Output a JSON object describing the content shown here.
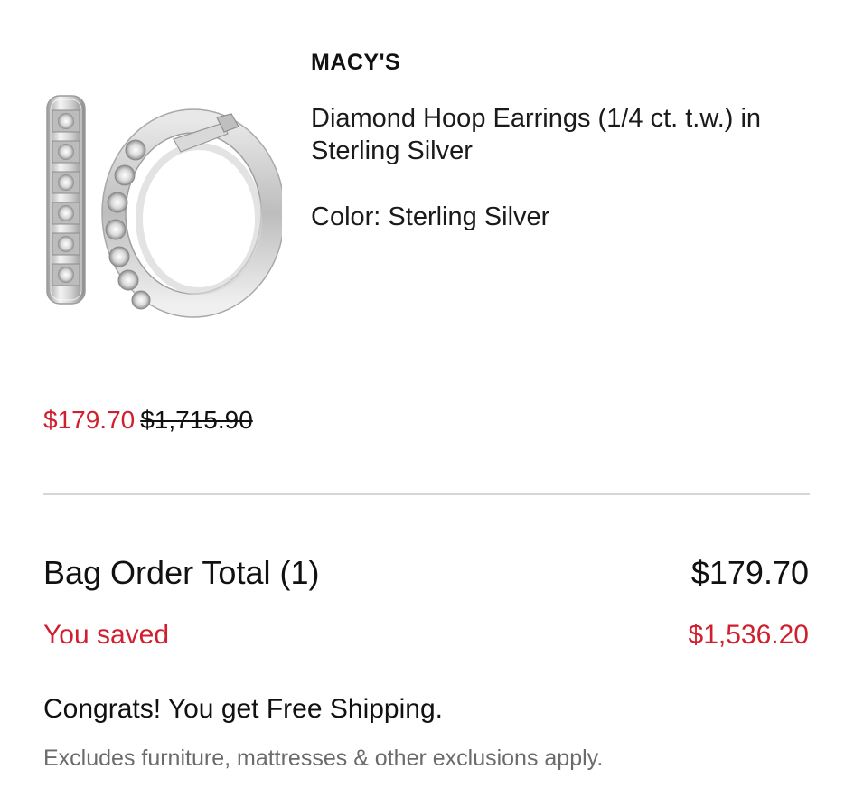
{
  "product": {
    "brand": "MACY'S",
    "name": "Diamond Hoop Earrings (1/4 ct. t.w.) in Sterling Silver",
    "color": "Color: Sterling Silver",
    "sale_price": "$179.70",
    "original_price": "$1,715.90",
    "image_icon": "diamond-hoop-earrings-image"
  },
  "summary": {
    "total_label": "Bag Order Total (1)",
    "total_value": "$179.70",
    "saved_label": "You saved",
    "saved_value": "$1,536.20",
    "shipping_message": "Congrats! You get Free Shipping.",
    "exclusions_note": "Excludes furniture, mattresses & other exclusions apply."
  },
  "colors": {
    "accent_red": "#d01f2f",
    "text_dark": "#111111",
    "text_muted": "#6b6b6b",
    "divider": "#d6d6d6"
  }
}
